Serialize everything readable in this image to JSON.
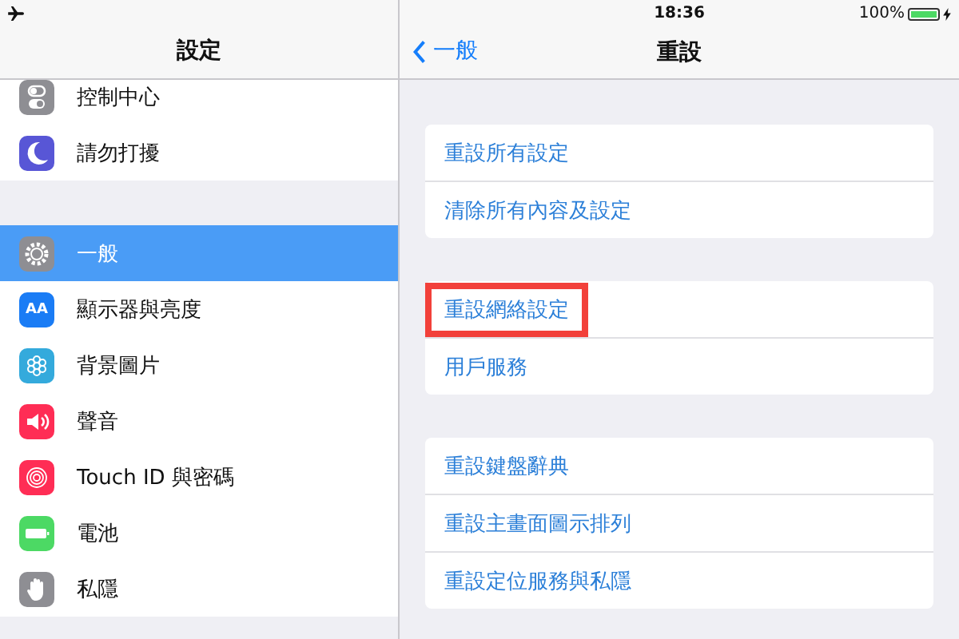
{
  "status_bar": {
    "airplane_mode": true,
    "time": "18:36",
    "battery": {
      "text": "100%",
      "level": 1
    },
    "charging": true
  },
  "sidebar": {
    "title": "設定",
    "groups": [
      [
        {
          "label": "控制中心",
          "kind": "toggles",
          "color": "#8e8e93",
          "selected": false
        },
        {
          "label": "請勿打擾",
          "kind": "moon",
          "color": "#5856d6",
          "selected": false
        }
      ],
      [
        {
          "label": "一般",
          "kind": "gear",
          "color": "#8e8e93",
          "selected": true
        },
        {
          "label": "顯示器與亮度",
          "kind": "text",
          "icon_text": "AA",
          "color": "#1a7cf5",
          "selected": false
        },
        {
          "label": "背景圖片",
          "kind": "flower",
          "color": "#34aadc",
          "selected": false
        },
        {
          "label": "聲音",
          "kind": "speaker",
          "color": "#ff2d55",
          "selected": false
        },
        {
          "label": "Touch ID 與密碼",
          "kind": "fingerprint",
          "color": "#ff2d55",
          "selected": false
        },
        {
          "label": "電池",
          "kind": "battery",
          "color": "#4cd964",
          "selected": false
        },
        {
          "label": "私隱",
          "kind": "hand",
          "color": "#8e8e93",
          "selected": false
        }
      ]
    ]
  },
  "detail": {
    "back": "一般",
    "title": "重設",
    "groups": [
      [
        {
          "label": "重設所有設定",
          "highlighted": false
        },
        {
          "label": "清除所有內容及設定",
          "highlighted": false
        }
      ],
      [
        {
          "label": "重設網絡設定",
          "highlighted": true
        },
        {
          "label": "用戶服務",
          "highlighted": false
        }
      ],
      [
        {
          "label": "重設鍵盤辭典",
          "highlighted": false
        },
        {
          "label": "重設主畫面圖示排列",
          "highlighted": false
        },
        {
          "label": "重設定位服務與私隱",
          "highlighted": false
        }
      ]
    ]
  }
}
